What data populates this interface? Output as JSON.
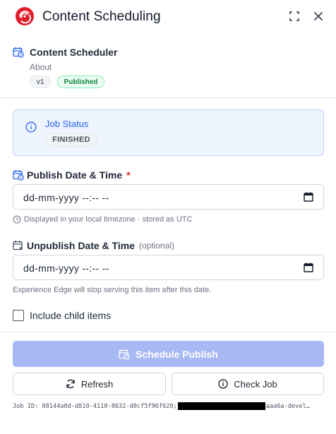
{
  "header": {
    "title": "Content Scheduling"
  },
  "info": {
    "title": "Content Scheduler",
    "about": "About",
    "version_badge": "v1",
    "status_badge": "Published"
  },
  "job_status": {
    "title": "Job Status",
    "value": "FINISHED"
  },
  "publish": {
    "label": "Publish Date & Time",
    "required_mark": "*",
    "value": "dd-mm-yyyy --:-- --",
    "hint": "Displayed in your local timezone · stored as UTC"
  },
  "unpublish": {
    "label": "Unpublish Date & Time",
    "optional": "(optional)",
    "value": "dd-mm-yyyy --:-- --",
    "hint": "Experience Edge will stop serving this item after this date."
  },
  "include_children": {
    "label": "Include child items",
    "checked": false
  },
  "actions": {
    "schedule_publish": "Schedule Publish",
    "refresh": "Refresh",
    "check_job": "Check Job"
  },
  "job_id": {
    "prefix": "Job ID: 88144a0d-d810-4110-8632-d0cf5f96f620;",
    "suffix": "aaa6a-devel…"
  },
  "colors": {
    "accent": "#2563eb",
    "primary_disabled": "#a7b8f3",
    "published_green": "#15803d",
    "required_red": "#dc2626",
    "logo_red": "#e11d2a"
  }
}
